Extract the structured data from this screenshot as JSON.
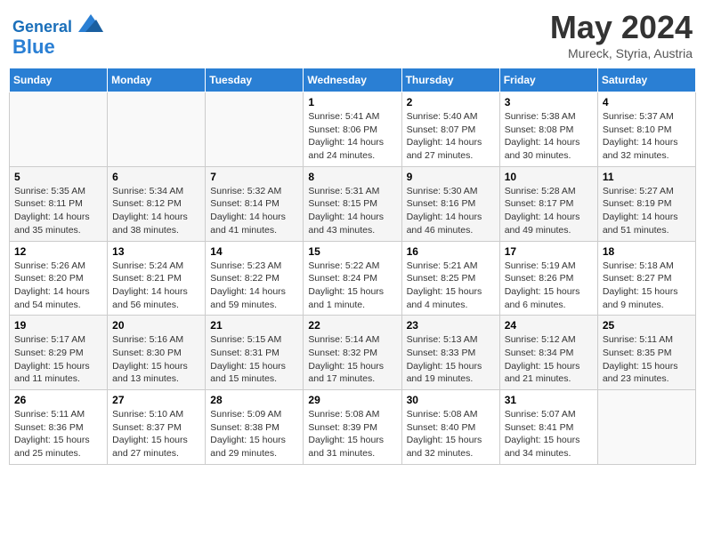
{
  "header": {
    "logo_line1": "General",
    "logo_line2": "Blue",
    "title": "May 2024",
    "subtitle": "Mureck, Styria, Austria"
  },
  "days_of_week": [
    "Sunday",
    "Monday",
    "Tuesday",
    "Wednesday",
    "Thursday",
    "Friday",
    "Saturday"
  ],
  "weeks": [
    [
      {
        "day": "",
        "info": ""
      },
      {
        "day": "",
        "info": ""
      },
      {
        "day": "",
        "info": ""
      },
      {
        "day": "1",
        "info": "Sunrise: 5:41 AM\nSunset: 8:06 PM\nDaylight: 14 hours and 24 minutes."
      },
      {
        "day": "2",
        "info": "Sunrise: 5:40 AM\nSunset: 8:07 PM\nDaylight: 14 hours and 27 minutes."
      },
      {
        "day": "3",
        "info": "Sunrise: 5:38 AM\nSunset: 8:08 PM\nDaylight: 14 hours and 30 minutes."
      },
      {
        "day": "4",
        "info": "Sunrise: 5:37 AM\nSunset: 8:10 PM\nDaylight: 14 hours and 32 minutes."
      }
    ],
    [
      {
        "day": "5",
        "info": "Sunrise: 5:35 AM\nSunset: 8:11 PM\nDaylight: 14 hours and 35 minutes."
      },
      {
        "day": "6",
        "info": "Sunrise: 5:34 AM\nSunset: 8:12 PM\nDaylight: 14 hours and 38 minutes."
      },
      {
        "day": "7",
        "info": "Sunrise: 5:32 AM\nSunset: 8:14 PM\nDaylight: 14 hours and 41 minutes."
      },
      {
        "day": "8",
        "info": "Sunrise: 5:31 AM\nSunset: 8:15 PM\nDaylight: 14 hours and 43 minutes."
      },
      {
        "day": "9",
        "info": "Sunrise: 5:30 AM\nSunset: 8:16 PM\nDaylight: 14 hours and 46 minutes."
      },
      {
        "day": "10",
        "info": "Sunrise: 5:28 AM\nSunset: 8:17 PM\nDaylight: 14 hours and 49 minutes."
      },
      {
        "day": "11",
        "info": "Sunrise: 5:27 AM\nSunset: 8:19 PM\nDaylight: 14 hours and 51 minutes."
      }
    ],
    [
      {
        "day": "12",
        "info": "Sunrise: 5:26 AM\nSunset: 8:20 PM\nDaylight: 14 hours and 54 minutes."
      },
      {
        "day": "13",
        "info": "Sunrise: 5:24 AM\nSunset: 8:21 PM\nDaylight: 14 hours and 56 minutes."
      },
      {
        "day": "14",
        "info": "Sunrise: 5:23 AM\nSunset: 8:22 PM\nDaylight: 14 hours and 59 minutes."
      },
      {
        "day": "15",
        "info": "Sunrise: 5:22 AM\nSunset: 8:24 PM\nDaylight: 15 hours and 1 minute."
      },
      {
        "day": "16",
        "info": "Sunrise: 5:21 AM\nSunset: 8:25 PM\nDaylight: 15 hours and 4 minutes."
      },
      {
        "day": "17",
        "info": "Sunrise: 5:19 AM\nSunset: 8:26 PM\nDaylight: 15 hours and 6 minutes."
      },
      {
        "day": "18",
        "info": "Sunrise: 5:18 AM\nSunset: 8:27 PM\nDaylight: 15 hours and 9 minutes."
      }
    ],
    [
      {
        "day": "19",
        "info": "Sunrise: 5:17 AM\nSunset: 8:29 PM\nDaylight: 15 hours and 11 minutes."
      },
      {
        "day": "20",
        "info": "Sunrise: 5:16 AM\nSunset: 8:30 PM\nDaylight: 15 hours and 13 minutes."
      },
      {
        "day": "21",
        "info": "Sunrise: 5:15 AM\nSunset: 8:31 PM\nDaylight: 15 hours and 15 minutes."
      },
      {
        "day": "22",
        "info": "Sunrise: 5:14 AM\nSunset: 8:32 PM\nDaylight: 15 hours and 17 minutes."
      },
      {
        "day": "23",
        "info": "Sunrise: 5:13 AM\nSunset: 8:33 PM\nDaylight: 15 hours and 19 minutes."
      },
      {
        "day": "24",
        "info": "Sunrise: 5:12 AM\nSunset: 8:34 PM\nDaylight: 15 hours and 21 minutes."
      },
      {
        "day": "25",
        "info": "Sunrise: 5:11 AM\nSunset: 8:35 PM\nDaylight: 15 hours and 23 minutes."
      }
    ],
    [
      {
        "day": "26",
        "info": "Sunrise: 5:11 AM\nSunset: 8:36 PM\nDaylight: 15 hours and 25 minutes."
      },
      {
        "day": "27",
        "info": "Sunrise: 5:10 AM\nSunset: 8:37 PM\nDaylight: 15 hours and 27 minutes."
      },
      {
        "day": "28",
        "info": "Sunrise: 5:09 AM\nSunset: 8:38 PM\nDaylight: 15 hours and 29 minutes."
      },
      {
        "day": "29",
        "info": "Sunrise: 5:08 AM\nSunset: 8:39 PM\nDaylight: 15 hours and 31 minutes."
      },
      {
        "day": "30",
        "info": "Sunrise: 5:08 AM\nSunset: 8:40 PM\nDaylight: 15 hours and 32 minutes."
      },
      {
        "day": "31",
        "info": "Sunrise: 5:07 AM\nSunset: 8:41 PM\nDaylight: 15 hours and 34 minutes."
      },
      {
        "day": "",
        "info": ""
      }
    ]
  ]
}
